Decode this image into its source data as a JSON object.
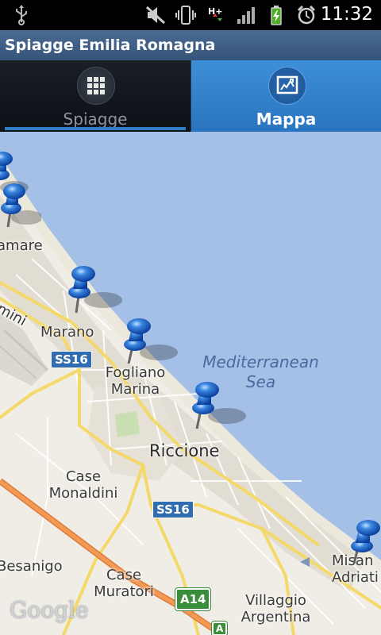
{
  "status_bar": {
    "time": "11:32",
    "icons": [
      "usb-icon",
      "mute-icon",
      "vibrate-icon",
      "hplus-data-icon",
      "signal-icon",
      "battery-charging-icon",
      "alarm-icon"
    ]
  },
  "app": {
    "title": "Spiagge Emilia Romagna"
  },
  "tabs": [
    {
      "label": "Spiagge",
      "icon": "grid-icon",
      "active": false
    },
    {
      "label": "Mappa",
      "icon": "map-icon",
      "active": true
    }
  ],
  "map": {
    "sea_label": [
      "Mediterranean",
      "Sea"
    ],
    "places": {
      "miramare": "amare",
      "rimini": "imini",
      "marano": "Marano",
      "fogliano": [
        "Fogliano",
        "Marina"
      ],
      "riccione": "Riccione",
      "case_monaldini": [
        "Case",
        "Monaldini"
      ],
      "besanigo": "Besanigo",
      "case_muratori": [
        "Case",
        "Muratori"
      ],
      "villaggio_argentina": [
        "Villaggio",
        "Argentina"
      ],
      "misano": [
        "Misan",
        "Adriati"
      ]
    },
    "road_labels": {
      "ss16_a": "SS16",
      "ss16_b": "SS16",
      "a14": "A14",
      "a14_cut": "A"
    },
    "attribution": "Google"
  }
}
